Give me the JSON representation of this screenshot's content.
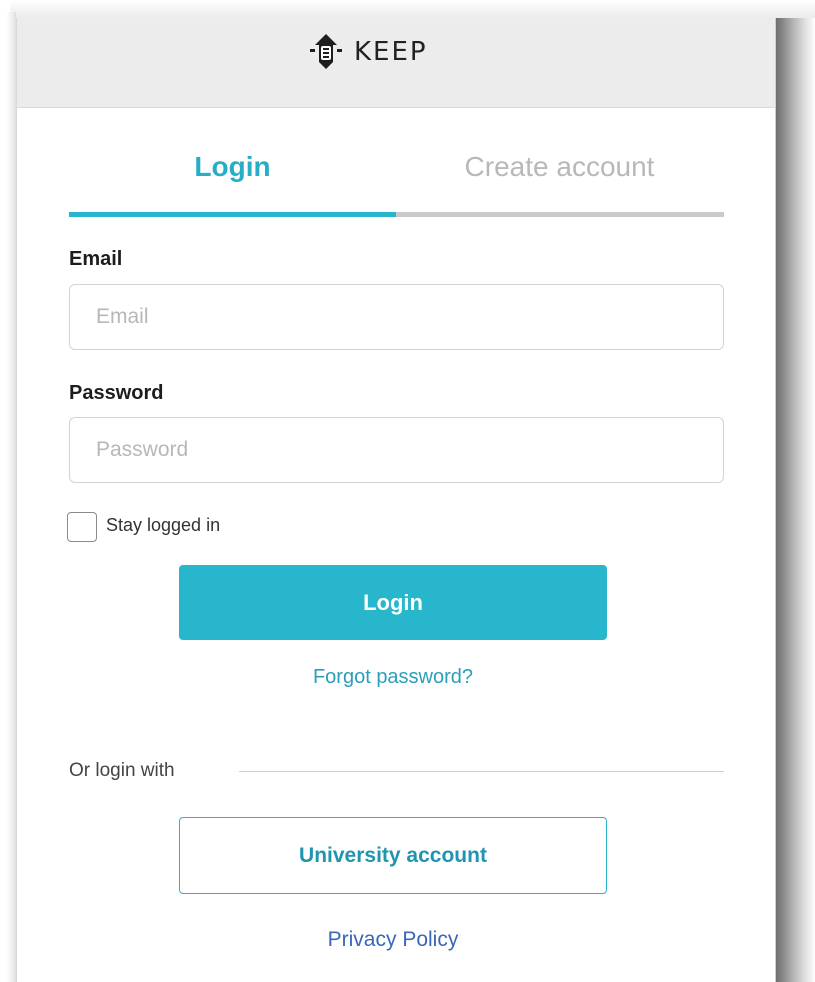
{
  "brand": {
    "name": "KEEP",
    "logo_icon": "keep-logo-icon"
  },
  "tabs": [
    {
      "label": "Login",
      "active": true
    },
    {
      "label": "Create account",
      "active": false
    }
  ],
  "form": {
    "email_label": "Email",
    "email_placeholder": "Email",
    "email_value": "",
    "password_label": "Password",
    "password_placeholder": "Password",
    "password_value": "",
    "stay_logged_in_label": "Stay logged in",
    "stay_logged_in_checked": false,
    "login_button_label": "Login",
    "forgot_password_link": "Forgot password?"
  },
  "alt_login": {
    "divider_text": "Or login with",
    "university_button_label": "University account"
  },
  "footer": {
    "privacy_link": "Privacy Policy"
  },
  "colors": {
    "accent": "#27b6cc",
    "active_tab_text": "#27aec7",
    "inactive_tab_text": "#b8b8b8",
    "link": "#2a9fb8",
    "privacy_link": "#3a67b7",
    "header_bg": "#ececec"
  }
}
